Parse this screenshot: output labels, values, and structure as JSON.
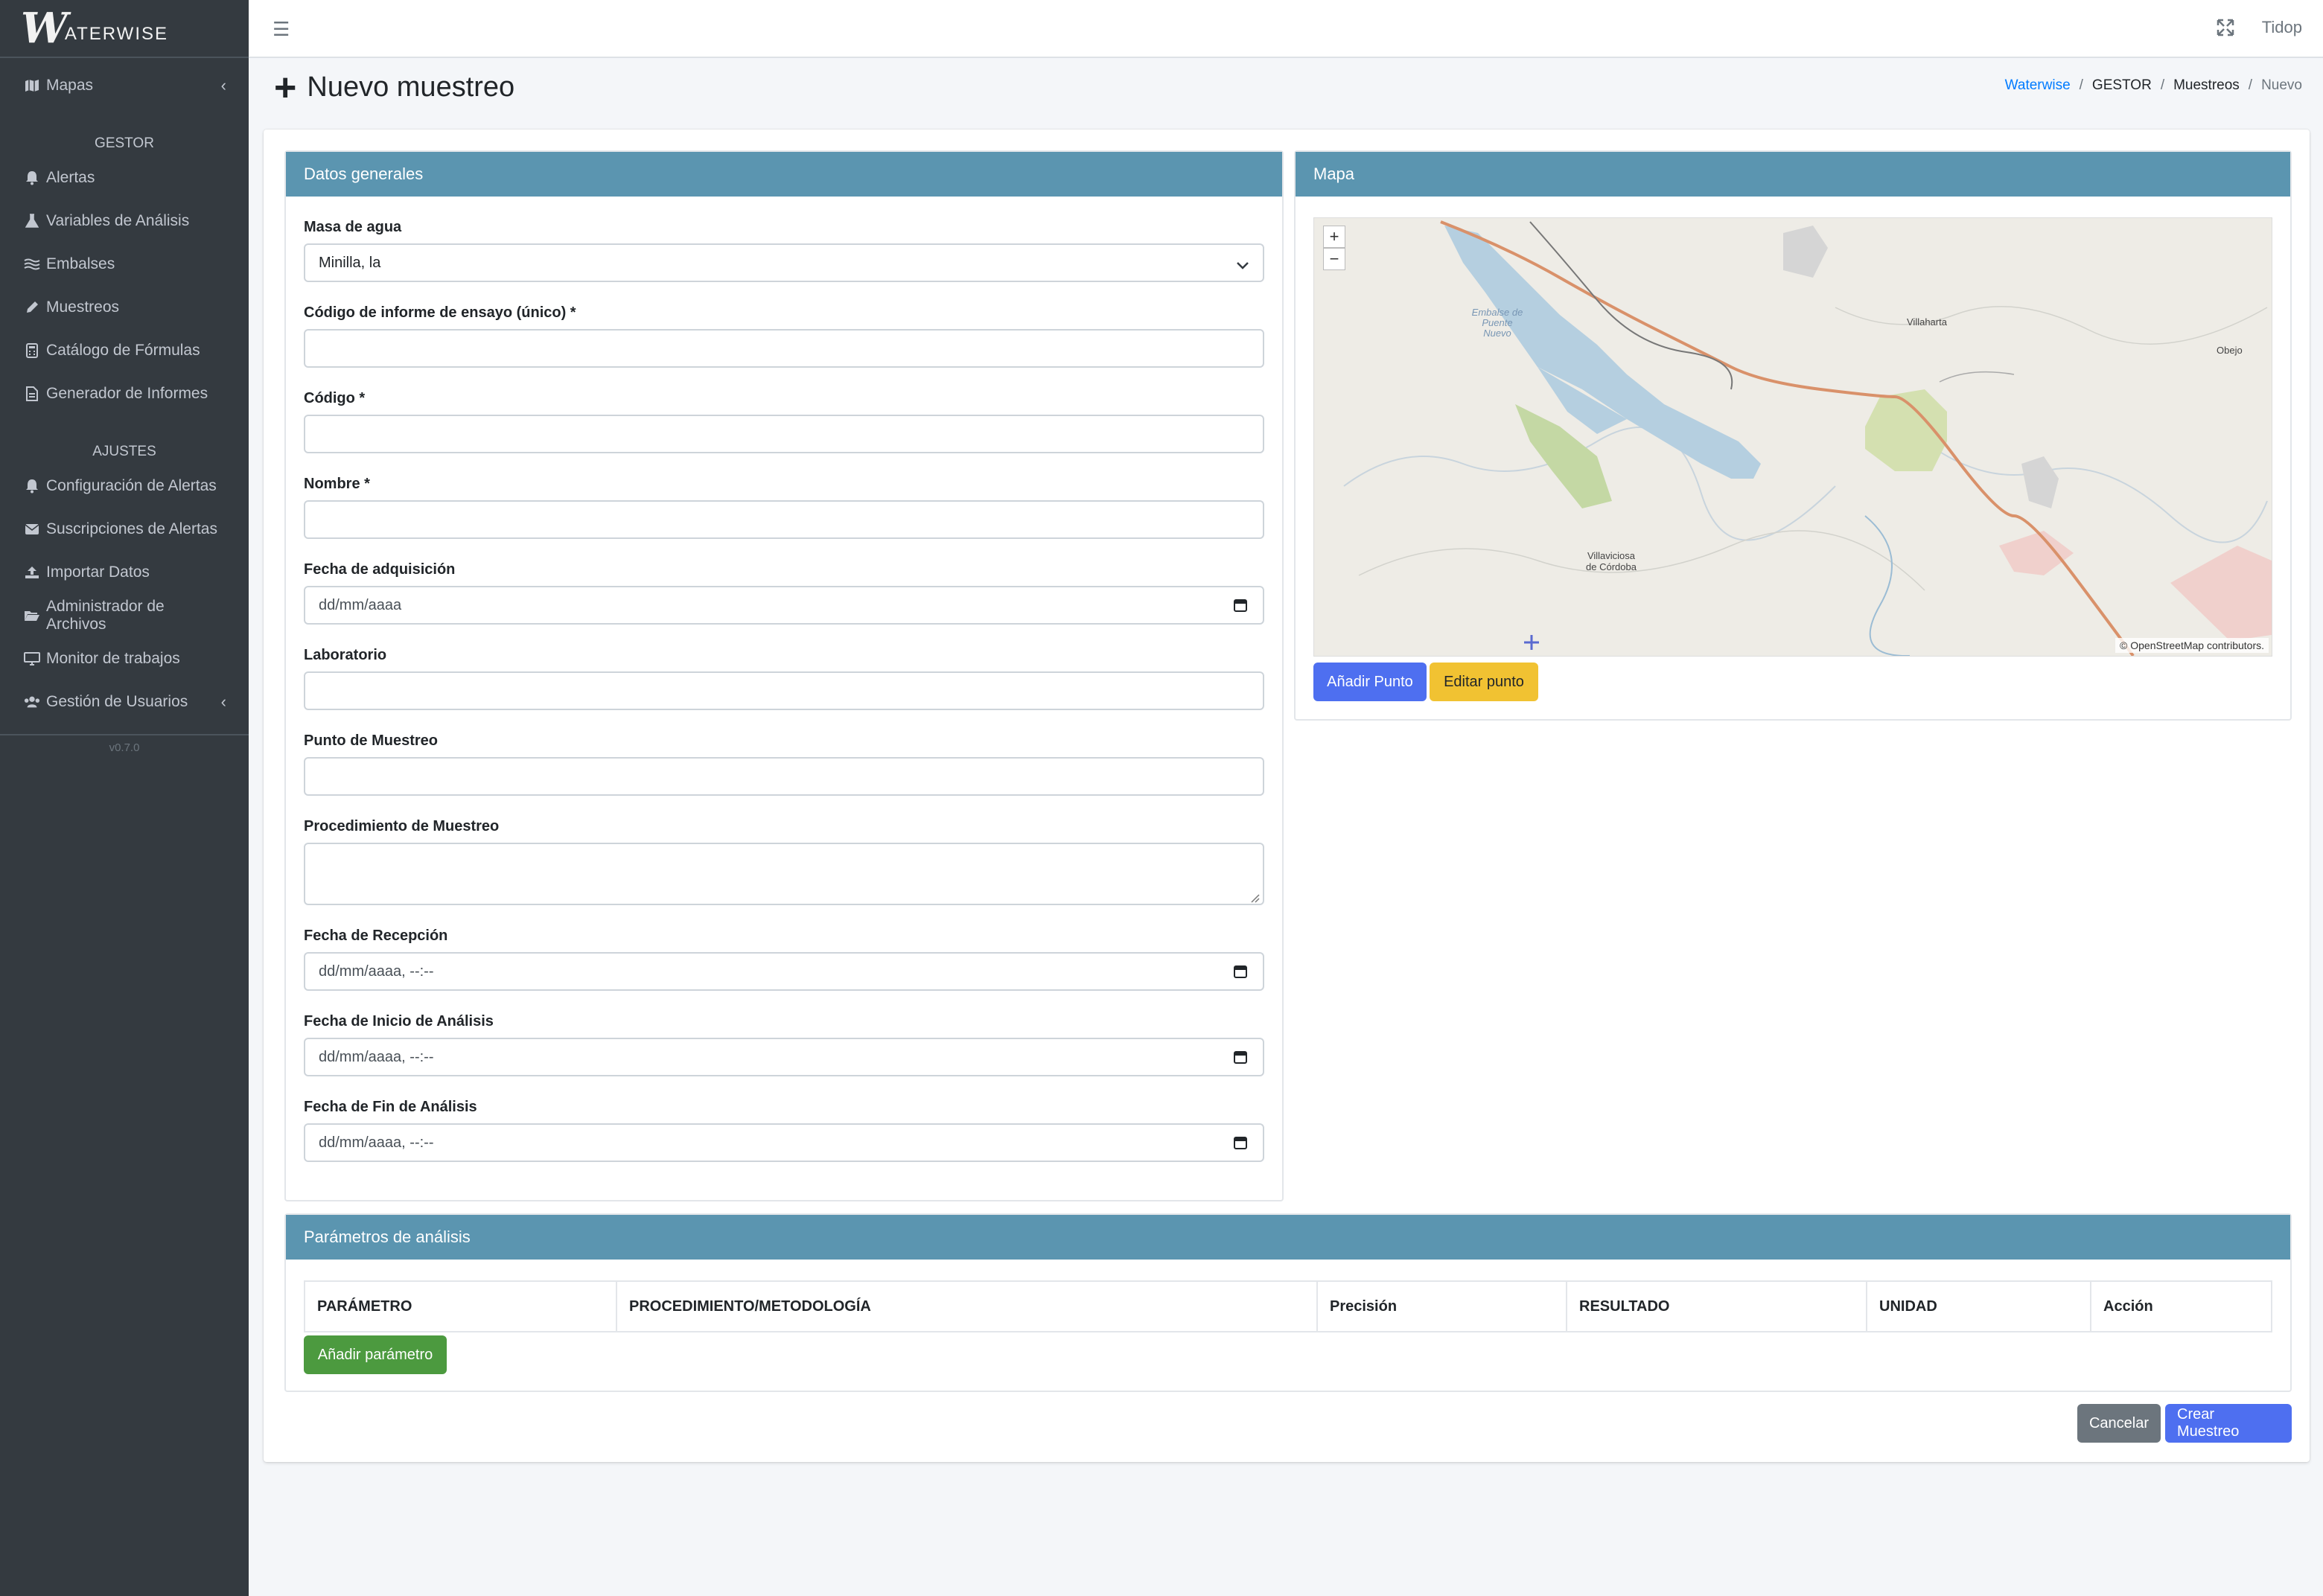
{
  "app": {
    "brand_letter": "W",
    "brand_rest": "ATERWISE",
    "version": "v0.7.0"
  },
  "sidebar": {
    "top_item": {
      "label": "Mapas",
      "icon": "map-icon"
    },
    "section_gestor": "GESTOR",
    "gestor_items": [
      {
        "label": "Alertas",
        "icon": "bell-icon"
      },
      {
        "label": "Variables de Análisis",
        "icon": "flask-icon"
      },
      {
        "label": "Embalses",
        "icon": "water-icon"
      },
      {
        "label": "Muestreos",
        "icon": "pen-icon"
      },
      {
        "label": "Catálogo de Fórmulas",
        "icon": "calculator-icon"
      },
      {
        "label": "Generador de Informes",
        "icon": "file-icon"
      }
    ],
    "section_ajustes": "AJUSTES",
    "ajustes_items": [
      {
        "label": "Configuración de Alertas",
        "icon": "bell-icon"
      },
      {
        "label": "Suscripciones de Alertas",
        "icon": "envelope-icon"
      },
      {
        "label": "Importar Datos",
        "icon": "upload-icon"
      },
      {
        "label": "Administrador de Archivos",
        "icon": "folder-open-icon"
      },
      {
        "label": "Monitor de trabajos",
        "icon": "desktop-icon"
      },
      {
        "label": "Gestión de Usuarios",
        "icon": "users-icon"
      }
    ]
  },
  "topbar": {
    "user": "Tidop"
  },
  "header": {
    "title": "Nuevo muestreo",
    "breadcrumb": [
      "Waterwise",
      "GESTOR",
      "Muestreos",
      "Nuevo"
    ]
  },
  "datos": {
    "title": "Datos generales",
    "masa_label": "Masa de agua",
    "masa_value": "Minilla, la",
    "codigo_informe_label": "Código de informe de ensayo (único) *",
    "codigo_label": "Código *",
    "nombre_label": "Nombre *",
    "fecha_adq_label": "Fecha de adquisición",
    "fecha_adq_placeholder": "dd/mm/aaaa",
    "laboratorio_label": "Laboratorio",
    "punto_label": "Punto de Muestreo",
    "procedimiento_label": "Procedimiento de Muestreo",
    "fecha_recep_label": "Fecha de Recepción",
    "fecha_inicio_label": "Fecha de Inicio de Análisis",
    "fecha_fin_label": "Fecha de Fin de Análisis",
    "datetime_placeholder": "dd/mm/aaaa, --:--"
  },
  "mapa": {
    "title": "Mapa",
    "zoom_in": "+",
    "zoom_out": "−",
    "attribution": "© OpenStreetMap contributors.",
    "places": [
      "Embalse de Puente Nuevo",
      "Villaharta",
      "Obejo",
      "Villaviciosa de Córdoba"
    ],
    "add_point": "Añadir Punto",
    "edit_point": "Editar punto"
  },
  "parametros": {
    "title": "Parámetros de análisis",
    "columns": [
      "PARÁMETRO",
      "PROCEDIMIENTO/METODOLOGÍA",
      "Precisión",
      "RESULTADO",
      "UNIDAD",
      "Acción"
    ],
    "add_button": "Añadir parámetro"
  },
  "actions": {
    "cancel": "Cancelar",
    "create": "Crear Muestreo"
  },
  "colors": {
    "sidebar": "#343a40",
    "panel_header": "#5b95b0",
    "primary": "#4e6ff0",
    "warning": "#f1c232",
    "success": "#4c9a3f",
    "secondary": "#6c757d"
  }
}
